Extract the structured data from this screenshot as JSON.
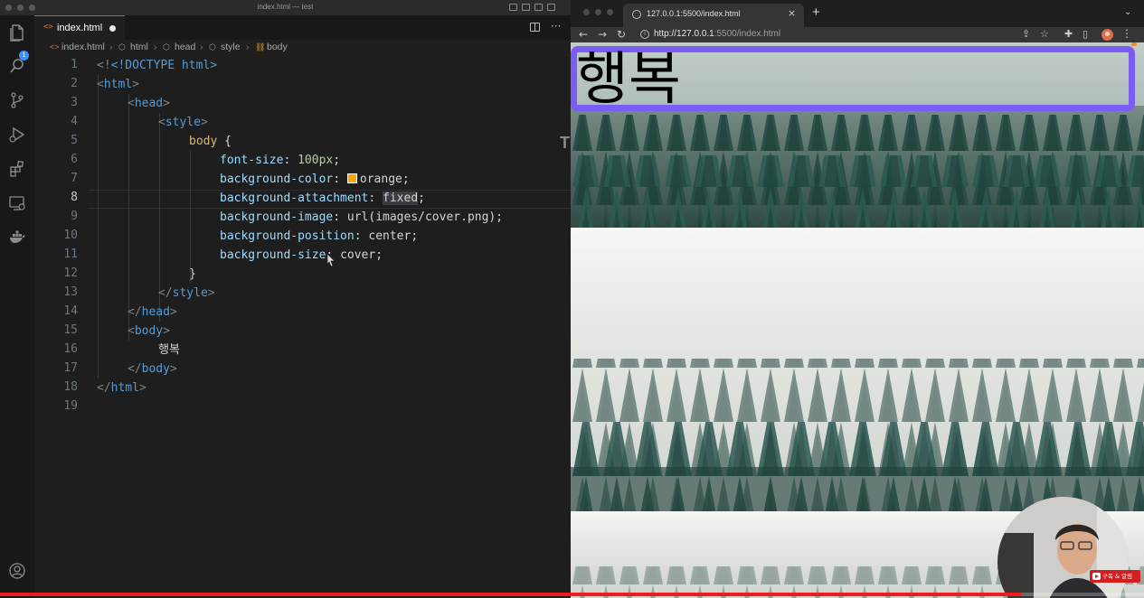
{
  "vscode": {
    "window_title": "index.html — test",
    "scm_badge": "1",
    "tab": {
      "icon_text": "<>",
      "label": "index.html",
      "modified": true
    },
    "breadcrumb": [
      "index.html",
      "html",
      "head",
      "style",
      "body"
    ],
    "active_line": 8,
    "line_numbers": [
      "1",
      "2",
      "3",
      "4",
      "5",
      "6",
      "7",
      "8",
      "9",
      "10",
      "11",
      "12",
      "13",
      "14",
      "15",
      "16",
      "17",
      "18",
      "19"
    ],
    "code": {
      "l1": "<!DOCTYPE html>",
      "l2_tag": "html",
      "l3_tag": "head",
      "l4_tag": "style",
      "l5_selector": "body",
      "l6_prop": "font-size",
      "l6_val": "100px",
      "l7_prop": "background-color",
      "l7_val": "orange",
      "l8_prop": "background-attachment",
      "l8_val": "fixed",
      "l9_prop": "background-image",
      "l9_val": "url(images/cover.png)",
      "l10_prop": "background-position",
      "l10_val": "center",
      "l11_prop_a": "background-siz",
      "l11_prop_b": "e",
      "l11_val": "cover",
      "l13_tag": "style",
      "l14_tag": "head",
      "l15_tag": "body",
      "l16_text": "행복",
      "l17_tag": "body",
      "l18_tag": "html"
    },
    "editor_edge_char": "T",
    "swatch_color": "#ffa500"
  },
  "browser": {
    "tab_title": "127.0.0.1:5500/index.html",
    "url_host": "http://127.0.0.1",
    "url_rest": ":5500/index.html",
    "page_heading": "행복",
    "highlight_color": "#7b5cf4"
  },
  "overlay": {
    "subscribe_label": "구독 & 알림",
    "video_progress_percent": 89.3,
    "progress_color": "#ee1c1c"
  }
}
